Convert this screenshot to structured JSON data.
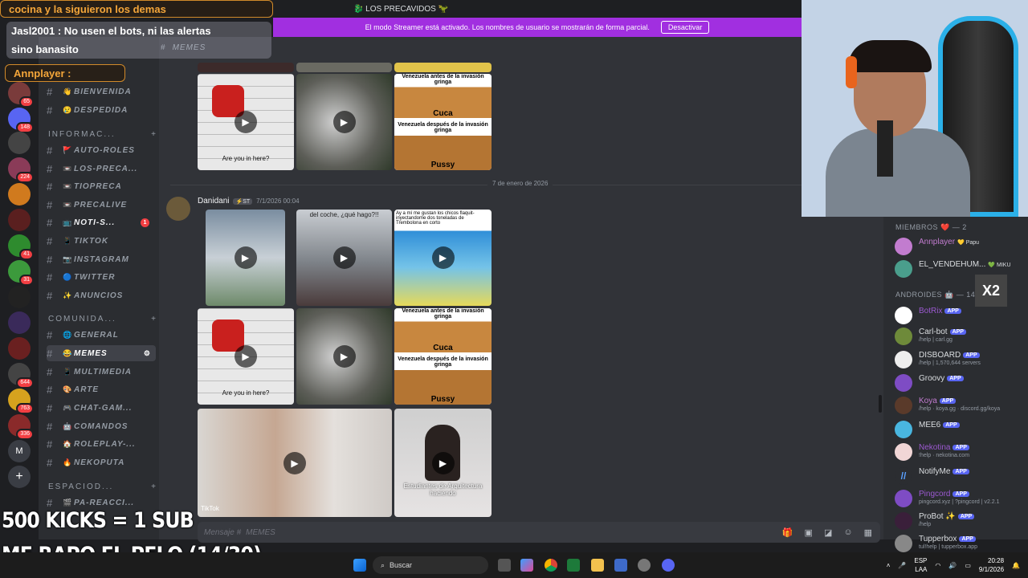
{
  "window": {
    "title": "🐉 LOS PRECAVIDOS 🦖"
  },
  "streamer_banner": {
    "text": "El modo Streamer está activado. Los nombres de usuario se mostrarán de forma parcial.",
    "button": "Desactivar",
    "color": "#a12fe0"
  },
  "overlay_chat": {
    "line_top": "cocina y la siguieron los demas",
    "msg1": "Jasl2001 : No usen el bots, ni las alertas",
    "msg1_cont": "sino banasito",
    "msg2": "Annplayer :",
    "accent": "#f4a63a"
  },
  "server_badges": [
    "65",
    "148",
    "224",
    "41",
    "31",
    "644",
    "763",
    "336"
  ],
  "server_letter": "M",
  "channel_header": "MEMES",
  "categories": {
    "info": "INFORMAC...",
    "comunidad": "COMUNIDA...",
    "espacio": "ESPACIOD..."
  },
  "channels": [
    {
      "name": "BIENVENIDA",
      "emoji": "👋"
    },
    {
      "name": "DESPEDIDA",
      "emoji": "😢"
    },
    {
      "name": "AUTO-ROLES",
      "emoji": "🚩"
    },
    {
      "name": "LOS-PRECA...",
      "emoji": "📼"
    },
    {
      "name": "TIOPRECA",
      "emoji": "📼"
    },
    {
      "name": "PRECALIVE",
      "emoji": "📼"
    },
    {
      "name": "NOTI-S...",
      "emoji": "📺",
      "unread": "1"
    },
    {
      "name": "TIKTOK",
      "emoji": "📱"
    },
    {
      "name": "INSTAGRAM",
      "emoji": "📷"
    },
    {
      "name": "TWITTER",
      "emoji": "🔵"
    },
    {
      "name": "ANUNCIOS",
      "emoji": "✨"
    },
    {
      "name": "GENERAL",
      "emoji": "🌐"
    },
    {
      "name": "MEMES",
      "emoji": "😂"
    },
    {
      "name": "MULTIMEDIA",
      "emoji": "📱"
    },
    {
      "name": "ARTE",
      "emoji": "🎨"
    },
    {
      "name": "CHAT-GAM...",
      "emoji": "🎮"
    },
    {
      "name": "COMANDOS",
      "emoji": "🤖"
    },
    {
      "name": "ROLEPLAY-...",
      "emoji": "🏠"
    },
    {
      "name": "NEKOPUTA",
      "emoji": "🔥"
    },
    {
      "name": "PA-REACCI...",
      "emoji": "🎬"
    }
  ],
  "messages": {
    "date_divider": "7 de enero de 2026",
    "author": "Danidani",
    "author_tag": "⚡ST",
    "timestamp": "7/1/2026 00:04",
    "captions": {
      "are_you": "Are you in here?",
      "meme_top": "Venezuela antes de la invasión gringa",
      "meme_word1": "Cuca",
      "meme_bottom": "Venezuela después de la invasión gringa",
      "meme_word2": "Pussy",
      "car_text": "del coche, ¿qué hago?!!",
      "goku_text": "Ay a mí me gustan los chicos flaquit- inyectandome dos toneladas de Trembolona en corto",
      "arq_text": "Estudiantes de Arquitectura haciendo",
      "tiktok": "TikTok"
    }
  },
  "composer": {
    "placeholder": "Mensaje #",
    "channel": "MEMES"
  },
  "members": {
    "header_top": "MIEMBROS ❤️ — 2",
    "header_androids": "ANDROIDES 🤖 — 14",
    "list": [
      {
        "name": "Annplayer",
        "badge": "💛 Papu",
        "status": "",
        "color": "#c27ccf"
      },
      {
        "name": "EL_VENDEHUM...",
        "badge": "💚 MIKU",
        "status": "",
        "color": "#dbdee1"
      },
      {
        "name": "BotRix",
        "badge": "APP",
        "status": "",
        "color": "#9b59d0"
      },
      {
        "name": "Carl-bot",
        "badge": "APP",
        "status": "/help | carl.gg",
        "color": "#dbdee1"
      },
      {
        "name": "DISBOARD",
        "badge": "APP",
        "status": "/help | 1,570,644 servers",
        "color": "#dbdee1"
      },
      {
        "name": "Groovy",
        "badge": "APP",
        "status": "",
        "color": "#dbdee1"
      },
      {
        "name": "Koya",
        "badge": "APP",
        "status": "/help · koya.gg · discord.gg/koya",
        "color": "#c27ccf"
      },
      {
        "name": "MEE6",
        "badge": "APP",
        "status": "",
        "color": "#dbdee1"
      },
      {
        "name": "Nekotina",
        "badge": "APP",
        "status": "!help · nekotina.com",
        "color": "#9b59d0"
      },
      {
        "name": "NotifyMe",
        "badge": "APP",
        "status": "",
        "color": "#dbdee1"
      },
      {
        "name": "Pingcord",
        "badge": "APP",
        "status": "pingcord.xyz | ?pingcord | v2.2.1",
        "color": "#9b59d0"
      },
      {
        "name": "ProBot ✨",
        "badge": "APP",
        "status": "/help",
        "color": "#dbdee1"
      },
      {
        "name": "Tupperbox",
        "badge": "APP",
        "status": "tul!help | tupperbox.app",
        "color": "#dbdee1"
      }
    ]
  },
  "stream_overlay": {
    "line1": "500 KICKS = 1 SUB",
    "line2": "ME RAPO EL PELO (14/30)",
    "x2": "X2"
  },
  "taskbar": {
    "search": "Buscar",
    "lang": "ESP",
    "lang2": "LAA",
    "time": "20:28",
    "date": "9/1/2026"
  }
}
